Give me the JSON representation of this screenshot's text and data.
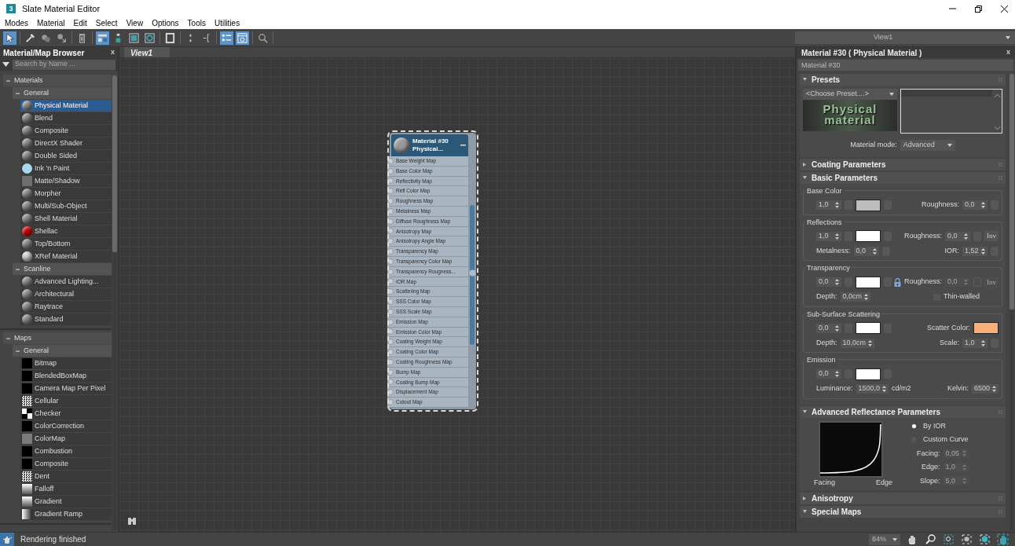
{
  "window": {
    "app_icon": "3",
    "title": "Slate Material Editor"
  },
  "menu": [
    "Modes",
    "Material",
    "Edit",
    "Select",
    "View",
    "Options",
    "Tools",
    "Utilities"
  ],
  "toolbar": [
    [
      {
        "kind": "cursor",
        "selected": true
      }
    ],
    [
      {
        "kind": "eyedropper",
        "selected": false
      },
      {
        "kind": "spheres",
        "selected": false
      },
      {
        "kind": "assign",
        "selected": false
      }
    ],
    [
      {
        "kind": "trash",
        "selected": false
      }
    ],
    [
      {
        "kind": "layout",
        "selected": true
      },
      {
        "kind": "children",
        "selected": false
      },
      {
        "kind": "background",
        "selected": false
      },
      {
        "kind": "target",
        "selected": false
      }
    ],
    [
      {
        "kind": "frame",
        "selected": false
      }
    ],
    [
      {
        "kind": "dots",
        "selected": false
      },
      {
        "kind": "branch",
        "selected": false
      }
    ],
    [
      {
        "kind": "list",
        "selected": true
      },
      {
        "kind": "window",
        "selected": true
      }
    ],
    [
      {
        "kind": "zoom",
        "selected": false
      }
    ]
  ],
  "view_selector": "View1",
  "browser": {
    "title": "Material/Map Browser",
    "close": "x",
    "search_placeholder": "Search by Name ...",
    "groups": [
      {
        "label": "Materials",
        "expanded": true,
        "children": [
          {
            "label": "General",
            "expanded": true,
            "children": [
              {
                "label": "Physical Material",
                "kind": "sphere",
                "color": "#8a8a8a",
                "selected": true
              },
              {
                "label": "Blend",
                "kind": "sphere",
                "color": "#8a8a8a",
                "selected": false
              },
              {
                "label": "Composite",
                "kind": "sphere",
                "color": "#8a8a8a",
                "selected": false
              },
              {
                "label": "DirectX Shader",
                "kind": "sphere",
                "color": "#8a8a8a",
                "selected": false
              },
              {
                "label": "Double Sided",
                "kind": "sphere",
                "color": "#8a8a8a",
                "selected": false
              },
              {
                "label": "Ink 'n Paint",
                "kind": "disc",
                "color": "#a6d8ef",
                "selected": false
              },
              {
                "label": "Matte/Shadow",
                "kind": "flat",
                "color": "#6e6e6e",
                "selected": false
              },
              {
                "label": "Morpher",
                "kind": "sphere",
                "color": "#8a8a8a",
                "selected": false
              },
              {
                "label": "Multi/Sub-Object",
                "kind": "sphere",
                "color": "#8a8a8a",
                "selected": false
              },
              {
                "label": "Shell Material",
                "kind": "sphere",
                "color": "#8a8a8a",
                "selected": false
              },
              {
                "label": "Shellac",
                "kind": "sphere",
                "color": "#d00000",
                "selected": false
              },
              {
                "label": "Top/Bottom",
                "kind": "sphere",
                "color": "#8a8a8a",
                "selected": false
              },
              {
                "label": "XRef Material",
                "kind": "sphere",
                "color": "#d4d4d4",
                "selected": false
              }
            ]
          },
          {
            "label": "Scanline",
            "expanded": true,
            "children": [
              {
                "label": "Advanced Lighting...",
                "kind": "sphere",
                "color": "#8a8a8a",
                "selected": false
              },
              {
                "label": "Architectural",
                "kind": "sphere",
                "color": "#8a8a8a",
                "selected": false
              },
              {
                "label": "Raytrace",
                "kind": "sphere",
                "color": "#8a8a8a",
                "selected": false
              },
              {
                "label": "Standard",
                "kind": "sphere",
                "color": "#8a8a8a",
                "selected": false
              }
            ]
          }
        ]
      },
      {
        "label": "Maps",
        "expanded": true,
        "children": [
          {
            "label": "General",
            "expanded": true,
            "children": [
              {
                "label": "Bitmap",
                "kind": "flat",
                "color": "#000000",
                "selected": false
              },
              {
                "label": "BlendedBoxMap",
                "kind": "flat",
                "color": "#000000",
                "selected": false
              },
              {
                "label": "Camera Map Per Pixel",
                "kind": "flat",
                "color": "#000000",
                "selected": false
              },
              {
                "label": "Cellular",
                "kind": "noise",
                "selected": false
              },
              {
                "label": "Checker",
                "kind": "checker",
                "selected": false
              },
              {
                "label": "ColorCorrection",
                "kind": "flat",
                "color": "#000000",
                "selected": false
              },
              {
                "label": "ColorMap",
                "kind": "flat",
                "color": "#7a7a7a",
                "selected": false
              },
              {
                "label": "Combustion",
                "kind": "flat",
                "color": "#000000",
                "selected": false
              },
              {
                "label": "Composite",
                "kind": "flat",
                "color": "#000000",
                "selected": false
              },
              {
                "label": "Dent",
                "kind": "noise",
                "selected": false
              },
              {
                "label": "Falloff",
                "kind": "gradient",
                "selected": false
              },
              {
                "label": "Gradient",
                "kind": "gradient",
                "selected": false
              },
              {
                "label": "Gradient Ramp",
                "kind": "ramp",
                "selected": false
              }
            ]
          }
        ]
      }
    ]
  },
  "tabs": [
    {
      "label": "View1",
      "selected": true
    }
  ],
  "node": {
    "title": "Material #30",
    "subtitle": "Physical...",
    "selected": true,
    "slots": [
      "Base Weight Map",
      "Base Color Map",
      "Reflectivity Map",
      "Refl Color Map",
      "Roughness Map",
      "Metalness Map",
      "Diffuse Roughness Map",
      "Anisotropy Map",
      "Anisotropy Angle Map",
      "Transparency Map",
      "Transparency Color Map",
      "Transparency Rougness...",
      "IOR Map",
      "Scattering Map",
      "SSS Color Map",
      "SSS Scale Map",
      "Emission Map",
      "Emission Color Map",
      "Coating Weight Map",
      "Coating Color Map",
      "Coating Roughness Map",
      "Bump Map",
      "Coating Bump Map",
      "Displacement Map",
      "Cutout Map"
    ]
  },
  "editor": {
    "title": "Material #30  ( Physical Material )",
    "close": "x",
    "name": "Material #30",
    "rollouts": [
      {
        "kind": "presets",
        "title": "Presets",
        "expanded": true,
        "preset": "<Choose Preset....>",
        "logo": [
          "Physical",
          "material"
        ],
        "mode_label": "Material mode:",
        "mode": "Advanced"
      },
      {
        "title": "Coating Parameters",
        "expanded": false
      },
      {
        "kind": "basic",
        "title": "Basic Parameters",
        "expanded": true,
        "groups": [
          {
            "title": "Base Color",
            "rows": [
              {
                "left": [
                  {
                    "kind": "spinner",
                    "value": "1,0",
                    "disabled": false
                  },
                  {
                    "kind": "map",
                    "disabled": false
                  },
                  {
                    "kind": "swatch",
                    "color": "#bdbdbd"
                  },
                  {
                    "kind": "map",
                    "disabled": false
                  }
                ],
                "right": [
                  {
                    "kind": "spinner",
                    "label": "Roughness:",
                    "value": "0,0",
                    "disabled": false
                  },
                  {
                    "kind": "map",
                    "disabled": false
                  }
                ]
              }
            ]
          },
          {
            "title": "Reflections",
            "rows": [
              {
                "left": [
                  {
                    "kind": "spinner",
                    "value": "1,0",
                    "disabled": false
                  },
                  {
                    "kind": "map",
                    "disabled": false
                  },
                  {
                    "kind": "swatch",
                    "color": "#ffffff"
                  },
                  {
                    "kind": "map",
                    "disabled": false
                  }
                ],
                "right": [
                  {
                    "kind": "spinner",
                    "label": "Roughness:",
                    "value": "0,0",
                    "disabled": false
                  },
                  {
                    "kind": "map",
                    "disabled": false
                  },
                  {
                    "kind": "toggle",
                    "label": "Inv",
                    "disabled": false
                  }
                ]
              },
              {
                "left": [
                  {
                    "kind": "spinner",
                    "label": "Metalness:",
                    "value": "0,0",
                    "disabled": false
                  },
                  {
                    "kind": "map",
                    "disabled": false
                  }
                ],
                "right": [
                  {
                    "kind": "spinner",
                    "label": "IOR:",
                    "value": "1,52",
                    "disabled": false
                  },
                  {
                    "kind": "map",
                    "disabled": false
                  }
                ]
              }
            ]
          },
          {
            "title": "Transparency",
            "rows": [
              {
                "left": [
                  {
                    "kind": "spinner",
                    "value": "0,0",
                    "disabled": false
                  },
                  {
                    "kind": "map",
                    "disabled": false
                  },
                  {
                    "kind": "swatch",
                    "color": "#ffffff"
                  },
                  {
                    "kind": "map",
                    "disabled": false
                  }
                ],
                "right": [
                  {
                    "kind": "lock"
                  },
                  {
                    "kind": "spinner",
                    "label": "Roughness:",
                    "value": "0,0",
                    "disabled": true
                  },
                  {
                    "kind": "map",
                    "disabled": true
                  },
                  {
                    "kind": "toggle",
                    "label": "Inv",
                    "disabled": true
                  }
                ]
              },
              {
                "left": [
                  {
                    "kind": "spinner",
                    "label": "Depth:",
                    "value": "0,0cm",
                    "disabled": false
                  }
                ],
                "right": [
                  {
                    "kind": "check",
                    "label": "Thin-walled",
                    "checked": false
                  }
                ]
              }
            ]
          },
          {
            "title": "Sub-Surface Scattering",
            "rows": [
              {
                "left": [
                  {
                    "kind": "spinner",
                    "value": "0,0",
                    "disabled": false
                  },
                  {
                    "kind": "map",
                    "disabled": false
                  },
                  {
                    "kind": "swatch",
                    "color": "#ffffff"
                  },
                  {
                    "kind": "map",
                    "disabled": false
                  }
                ],
                "right": [
                  {
                    "kind": "swatch",
                    "label": "Scatter Color:",
                    "color": "#f8b07a"
                  }
                ]
              },
              {
                "left": [
                  {
                    "kind": "spinner",
                    "label": "Depth:",
                    "value": "10,0cm",
                    "disabled": false
                  }
                ],
                "right": [
                  {
                    "kind": "spinner",
                    "label": "Scale:",
                    "value": "1,0",
                    "disabled": false
                  },
                  {
                    "kind": "map",
                    "disabled": false
                  }
                ]
              }
            ]
          },
          {
            "title": "Emission",
            "rows": [
              {
                "left": [
                  {
                    "kind": "spinner",
                    "value": "0,0",
                    "disabled": false
                  },
                  {
                    "kind": "map",
                    "disabled": false
                  },
                  {
                    "kind": "swatch",
                    "color": "#ffffff"
                  },
                  {
                    "kind": "map",
                    "disabled": false
                  }
                ],
                "right": []
              },
              {
                "left": [
                  {
                    "kind": "spinner",
                    "label": "Luminance:",
                    "value": "1500,0",
                    "disabled": false
                  },
                  {
                    "kind": "text",
                    "text": "cd/m2"
                  }
                ],
                "right": [
                  {
                    "kind": "spinner",
                    "label": "Kelvin:",
                    "value": "6500",
                    "disabled": false
                  }
                ]
              }
            ]
          }
        ]
      },
      {
        "kind": "reflectance",
        "title": "Advanced Reflectance Parameters",
        "expanded": true,
        "curve_labels": [
          "Facing",
          "Edge"
        ],
        "options": [
          {
            "label": "By IOR",
            "selected": true
          },
          {
            "label": "Custom Curve",
            "selected": false
          }
        ],
        "spinners": [
          {
            "label": "Facing:",
            "value": "0,05",
            "disabled": true
          },
          {
            "label": "Edge:",
            "value": "1,0",
            "disabled": true
          },
          {
            "label": "Slope:",
            "value": "5,0",
            "disabled": true
          }
        ]
      },
      {
        "title": "Anisotropy",
        "expanded": false
      },
      {
        "title": "Special Maps",
        "expanded": true
      }
    ]
  },
  "status": {
    "message": "Rendering finished",
    "zoom": "84%"
  }
}
